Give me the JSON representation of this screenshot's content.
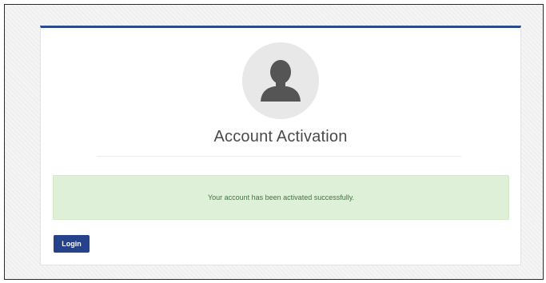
{
  "card": {
    "accent_color": "#2c4a8e",
    "avatar_icon": "user-silhouette-icon",
    "title": "Account Activation"
  },
  "alert": {
    "message": "Your account has been activated successfully.",
    "background_color": "#dff0d8",
    "text_color": "#3c763d"
  },
  "actions": {
    "login_label": "Login",
    "login_color": "#25428b"
  }
}
